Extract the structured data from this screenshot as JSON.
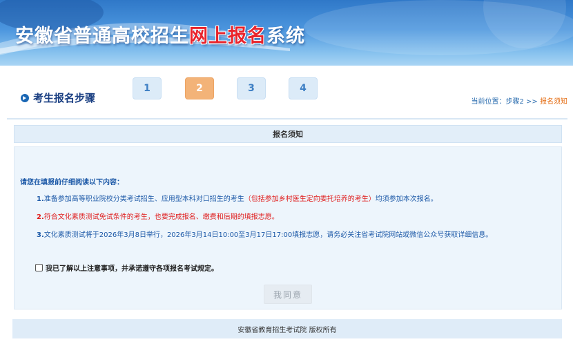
{
  "banner": {
    "title_part1": "安徽省普通高校招生",
    "title_highlight": "网上报名",
    "title_part2": "系统"
  },
  "steps": {
    "title": "考生报名步骤",
    "items": [
      "1",
      "2",
      "3",
      "4"
    ],
    "active_index": 1,
    "location_prefix": "当前位置：步骤2 >> ",
    "location_current": "报名须知"
  },
  "notice": {
    "header": "报名须知",
    "intro": "请您在填报前仔细阅读以下内容：",
    "item1_num": "1.",
    "item1_text_a": "准备参加高等职业院校分类考试招生、应用型本科对口招生的考生",
    "item1_text_red": "（包括参加乡村医生定向委托培养的考生）",
    "item1_text_b": "均须参加本次报名。",
    "item2_num": "2.",
    "item2_text": "符合文化素质测试免试条件的考生，也要完成报名、缴费和后期的填报志愿。",
    "item3_num": "3.",
    "item3_text": "文化素质测试将于2026年3月8日举行，2026年3月14日10:00至3月17日17:00填报志愿，请务必关注省考试院网站或微信公众号获取详细信息。"
  },
  "agree": {
    "checkbox_label": "我已了解以上注意事项，并承诺遵守各项报名考试规定。",
    "checked": false,
    "button_label": "我同意"
  },
  "footer": {
    "text": "安徽省教育招生考试院 版权所有"
  },
  "colors": {
    "accent": "#1a67b4",
    "highlight": "#e02020",
    "active_step": "#f3b378",
    "location_current": "#e46b10"
  }
}
